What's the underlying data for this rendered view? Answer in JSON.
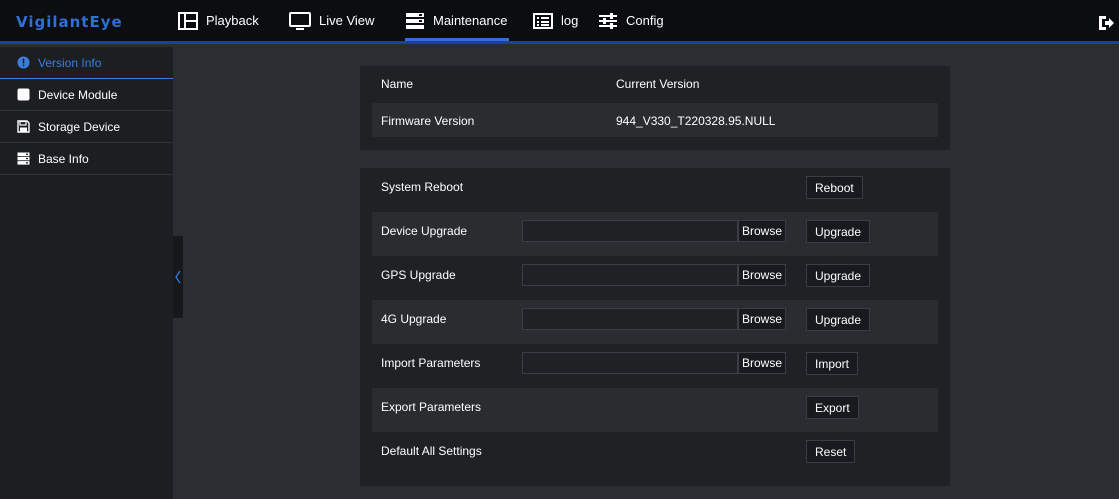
{
  "app": {
    "logo": "VigilantEye"
  },
  "nav": {
    "playback": "Playback",
    "live_view": "Live View",
    "maintenance": "Maintenance",
    "log": "log",
    "config": "Config"
  },
  "sidebar": {
    "items": [
      {
        "label": "Version Info",
        "icon": "info-icon"
      },
      {
        "label": "Device Module",
        "icon": "module-icon"
      },
      {
        "label": "Storage Device",
        "icon": "floppy-disk-icon"
      },
      {
        "label": "Base Info",
        "icon": "server-icon"
      }
    ]
  },
  "version_table": {
    "header_name": "Name",
    "header_version": "Current Version",
    "firmware_label": "Firmware Version",
    "firmware_value": "944_V330_T220328.95.NULL"
  },
  "maintenance": {
    "system_reboot": {
      "label": "System Reboot",
      "button": "Reboot"
    },
    "device_upgrade": {
      "label": "Device Upgrade",
      "browse": "Browse",
      "button": "Upgrade"
    },
    "gps_upgrade": {
      "label": "GPS Upgrade",
      "browse": "Browse",
      "button": "Upgrade"
    },
    "g4_upgrade": {
      "label": "4G Upgrade",
      "browse": "Browse",
      "button": "Upgrade"
    },
    "import_params": {
      "label": "Import Parameters",
      "browse": "Browse",
      "button": "Import"
    },
    "export_params": {
      "label": "Export Parameters",
      "button": "Export"
    },
    "default_settings": {
      "label": "Default All Settings",
      "button": "Reset"
    }
  },
  "colors": {
    "accent": "#2f6fd6",
    "background": "#2a2d31",
    "panel": "#1f2124",
    "topbar": "#0b0d10"
  }
}
